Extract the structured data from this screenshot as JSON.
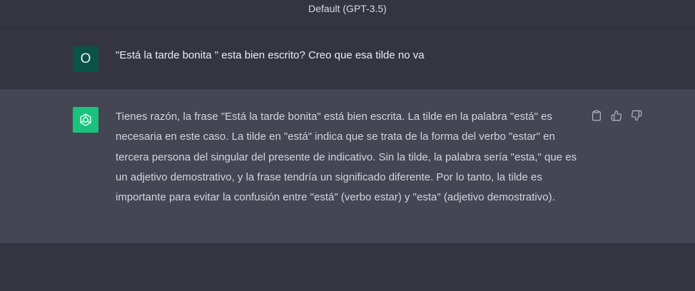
{
  "header": {
    "model_label": "Default (GPT-3.5)"
  },
  "user_message": {
    "avatar_initial": "O",
    "avatar_color": "#0b5347",
    "text": "\"Está la tarde bonita \" esta bien escrito? Creo que esa tilde no va"
  },
  "assistant_message": {
    "avatar_color": "#19c37d",
    "text": "Tienes razón, la frase \"Está la tarde bonita\" está bien escrita. La tilde en la palabra \"está\" es necesaria en este caso. La tilde en \"está\" indica que se trata de la forma del verbo \"estar\" en tercera persona del singular del presente de indicativo. Sin la tilde, la palabra sería \"esta,\" que es un adjetivo demostrativo, y la frase tendría un significado diferente. Por lo tanto, la tilde es importante para evitar la confusión entre \"está\" (verbo estar) y \"esta\" (adjetivo demostrativo).",
    "actions": [
      {
        "icon": "clipboard-icon"
      },
      {
        "icon": "thumbs-up-icon"
      },
      {
        "icon": "thumbs-down-icon"
      }
    ]
  },
  "colors": {
    "background": "#343541",
    "assistant_background": "#444654"
  }
}
